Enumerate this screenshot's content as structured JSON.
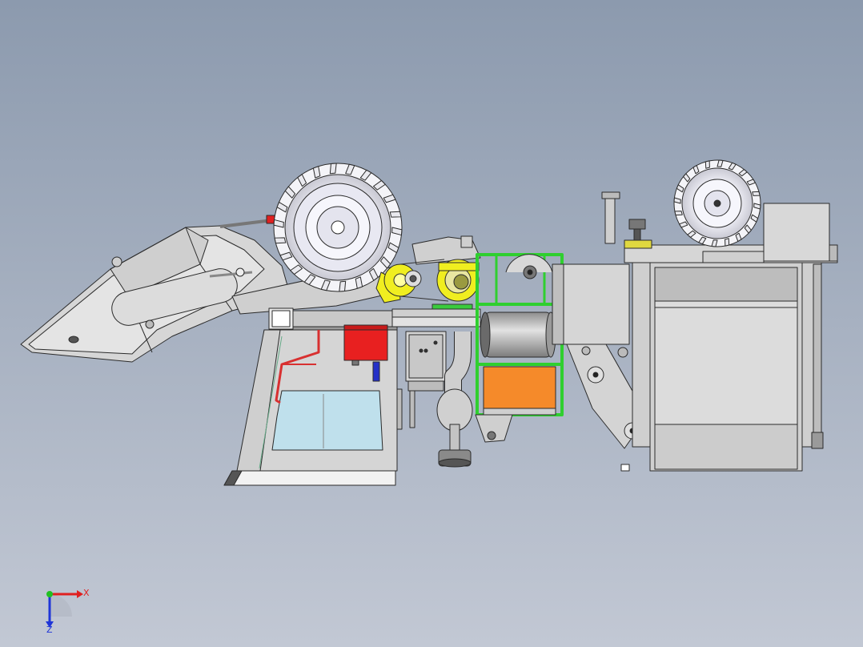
{
  "viewport": {
    "background_top": "#8c9aae",
    "background_bottom": "#c2c8d4"
  },
  "triad": {
    "x_label": "X",
    "z_label": "Z",
    "x_color": "#e02020",
    "z_color": "#1f35d8",
    "y_color": "#22c022"
  },
  "model": {
    "colors": {
      "body": "#d9d9d9",
      "body_dark": "#bdbdbd",
      "line": "#2b2b2b",
      "frame_green": "#2fcf2f",
      "hopper_orange": "#f58a2a",
      "motor_red": "#e82020",
      "pipe_red": "#d83030",
      "pulley_yellow": "#f0ee20",
      "glass": "#bfe0ec",
      "accent_blue": "#2430c8"
    },
    "parts": [
      "header-platform",
      "front-wheel",
      "rear-wheel",
      "cab",
      "engine-block",
      "grain-hopper",
      "threshing-drum",
      "drive-pulley",
      "red-motor",
      "green-frame",
      "exhaust-pipe",
      "elevator-arm",
      "storage-bin",
      "top-box"
    ]
  }
}
